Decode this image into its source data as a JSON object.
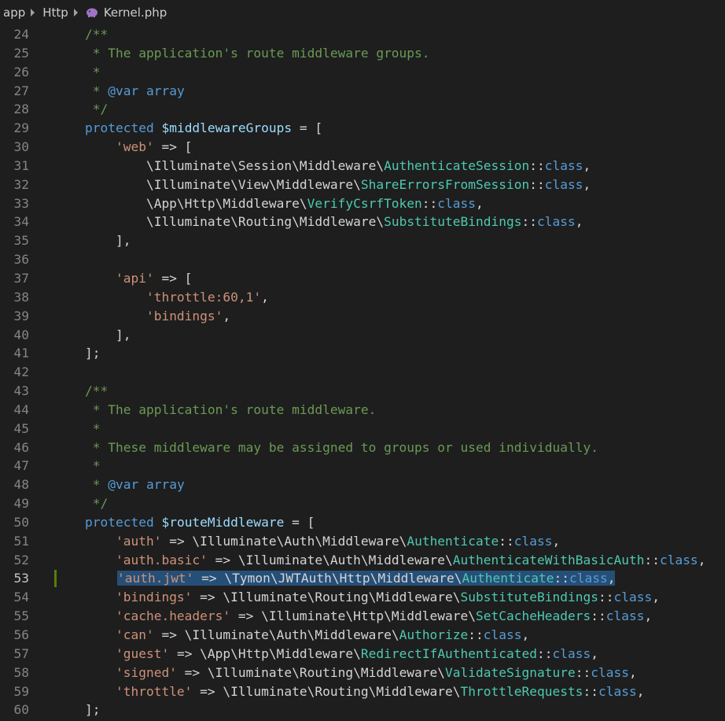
{
  "breadcrumb": {
    "items": [
      "app",
      "Http",
      "Kernel.php"
    ]
  },
  "editor": {
    "active_line": 53,
    "modified_line": 53,
    "lines": [
      {
        "n": "24",
        "tokens": [
          [
            "cm",
            "    /**"
          ]
        ]
      },
      {
        "n": "25",
        "tokens": [
          [
            "cm",
            "     * The application's route middleware groups."
          ]
        ]
      },
      {
        "n": "26",
        "tokens": [
          [
            "cm",
            "     *"
          ]
        ]
      },
      {
        "n": "27",
        "tokens": [
          [
            "cm",
            "     * "
          ],
          [
            "kw",
            "@var"
          ],
          [
            "cm",
            " "
          ],
          [
            "kw",
            "array"
          ]
        ]
      },
      {
        "n": "28",
        "tokens": [
          [
            "cm",
            "     */"
          ]
        ]
      },
      {
        "n": "29",
        "tokens": [
          [
            "kw",
            "    protected "
          ],
          [
            "var",
            "$middlewareGroups"
          ],
          [
            "op",
            " = ["
          ]
        ]
      },
      {
        "n": "30",
        "tokens": [
          [
            "op",
            "        "
          ],
          [
            "str",
            "'web'"
          ],
          [
            "op",
            " => ["
          ]
        ]
      },
      {
        "n": "31",
        "tokens": [
          [
            "op",
            "            \\Illuminate\\Session\\Middleware\\"
          ],
          [
            "cls",
            "AuthenticateSession"
          ],
          [
            "op",
            "::"
          ],
          [
            "kw",
            "class"
          ],
          [
            "op",
            ","
          ]
        ]
      },
      {
        "n": "32",
        "tokens": [
          [
            "op",
            "            \\Illuminate\\View\\Middleware\\"
          ],
          [
            "cls",
            "ShareErrorsFromSession"
          ],
          [
            "op",
            "::"
          ],
          [
            "kw",
            "class"
          ],
          [
            "op",
            ","
          ]
        ]
      },
      {
        "n": "33",
        "tokens": [
          [
            "op",
            "            \\App\\Http\\Middleware\\"
          ],
          [
            "cls",
            "VerifyCsrfToken"
          ],
          [
            "op",
            "::"
          ],
          [
            "kw",
            "class"
          ],
          [
            "op",
            ","
          ]
        ]
      },
      {
        "n": "34",
        "tokens": [
          [
            "op",
            "            \\Illuminate\\Routing\\Middleware\\"
          ],
          [
            "cls",
            "SubstituteBindings"
          ],
          [
            "op",
            "::"
          ],
          [
            "kw",
            "class"
          ],
          [
            "op",
            ","
          ]
        ]
      },
      {
        "n": "35",
        "tokens": [
          [
            "op",
            "        ],"
          ]
        ]
      },
      {
        "n": "36",
        "tokens": []
      },
      {
        "n": "37",
        "tokens": [
          [
            "op",
            "        "
          ],
          [
            "str",
            "'api'"
          ],
          [
            "op",
            " => ["
          ]
        ]
      },
      {
        "n": "38",
        "tokens": [
          [
            "op",
            "            "
          ],
          [
            "str",
            "'throttle:60,1'"
          ],
          [
            "op",
            ","
          ]
        ]
      },
      {
        "n": "39",
        "tokens": [
          [
            "op",
            "            "
          ],
          [
            "str",
            "'bindings'"
          ],
          [
            "op",
            ","
          ]
        ]
      },
      {
        "n": "40",
        "tokens": [
          [
            "op",
            "        ],"
          ]
        ]
      },
      {
        "n": "41",
        "tokens": [
          [
            "op",
            "    ];"
          ]
        ]
      },
      {
        "n": "42",
        "tokens": []
      },
      {
        "n": "43",
        "tokens": [
          [
            "cm",
            "    /**"
          ]
        ]
      },
      {
        "n": "44",
        "tokens": [
          [
            "cm",
            "     * The application's route middleware."
          ]
        ]
      },
      {
        "n": "45",
        "tokens": [
          [
            "cm",
            "     *"
          ]
        ]
      },
      {
        "n": "46",
        "tokens": [
          [
            "cm",
            "     * These middleware may be assigned to groups or used individually."
          ]
        ]
      },
      {
        "n": "47",
        "tokens": [
          [
            "cm",
            "     *"
          ]
        ]
      },
      {
        "n": "48",
        "tokens": [
          [
            "cm",
            "     * "
          ],
          [
            "kw",
            "@var"
          ],
          [
            "cm",
            " "
          ],
          [
            "kw",
            "array"
          ]
        ]
      },
      {
        "n": "49",
        "tokens": [
          [
            "cm",
            "     */"
          ]
        ]
      },
      {
        "n": "50",
        "tokens": [
          [
            "kw",
            "    protected "
          ],
          [
            "var",
            "$routeMiddleware"
          ],
          [
            "op",
            " = ["
          ]
        ]
      },
      {
        "n": "51",
        "tokens": [
          [
            "op",
            "        "
          ],
          [
            "str",
            "'auth'"
          ],
          [
            "op",
            " => \\Illuminate\\Auth\\Middleware\\"
          ],
          [
            "cls",
            "Authenticate"
          ],
          [
            "op",
            "::"
          ],
          [
            "kw",
            "class"
          ],
          [
            "op",
            ","
          ]
        ]
      },
      {
        "n": "52",
        "tokens": [
          [
            "op",
            "        "
          ],
          [
            "str",
            "'auth.basic'"
          ],
          [
            "op",
            " => \\Illuminate\\Auth\\Middleware\\"
          ],
          [
            "cls",
            "AuthenticateWithBasicAuth"
          ],
          [
            "op",
            "::"
          ],
          [
            "kw",
            "class"
          ],
          [
            "op",
            ","
          ]
        ]
      },
      {
        "n": "53",
        "tokens": [
          [
            "op",
            "        "
          ],
          [
            "str",
            "'auth.jwt'"
          ],
          [
            "op",
            " => \\Tymon\\JWTAuth\\Http\\Middleware\\"
          ],
          [
            "cls",
            "Authenticate"
          ],
          [
            "op",
            "::"
          ],
          [
            "kw",
            "class"
          ],
          [
            "op",
            ","
          ]
        ]
      },
      {
        "n": "54",
        "tokens": [
          [
            "op",
            "        "
          ],
          [
            "str",
            "'bindings'"
          ],
          [
            "op",
            " => \\Illuminate\\Routing\\Middleware\\"
          ],
          [
            "cls",
            "SubstituteBindings"
          ],
          [
            "op",
            "::"
          ],
          [
            "kw",
            "class"
          ],
          [
            "op",
            ","
          ]
        ]
      },
      {
        "n": "55",
        "tokens": [
          [
            "op",
            "        "
          ],
          [
            "str",
            "'cache.headers'"
          ],
          [
            "op",
            " => \\Illuminate\\Http\\Middleware\\"
          ],
          [
            "cls",
            "SetCacheHeaders"
          ],
          [
            "op",
            "::"
          ],
          [
            "kw",
            "class"
          ],
          [
            "op",
            ","
          ]
        ]
      },
      {
        "n": "56",
        "tokens": [
          [
            "op",
            "        "
          ],
          [
            "str",
            "'can'"
          ],
          [
            "op",
            " => \\Illuminate\\Auth\\Middleware\\"
          ],
          [
            "cls",
            "Authorize"
          ],
          [
            "op",
            "::"
          ],
          [
            "kw",
            "class"
          ],
          [
            "op",
            ","
          ]
        ]
      },
      {
        "n": "57",
        "tokens": [
          [
            "op",
            "        "
          ],
          [
            "str",
            "'guest'"
          ],
          [
            "op",
            " => \\App\\Http\\Middleware\\"
          ],
          [
            "cls",
            "RedirectIfAuthenticated"
          ],
          [
            "op",
            "::"
          ],
          [
            "kw",
            "class"
          ],
          [
            "op",
            ","
          ]
        ]
      },
      {
        "n": "58",
        "tokens": [
          [
            "op",
            "        "
          ],
          [
            "str",
            "'signed'"
          ],
          [
            "op",
            " => \\Illuminate\\Routing\\Middleware\\"
          ],
          [
            "cls",
            "ValidateSignature"
          ],
          [
            "op",
            "::"
          ],
          [
            "kw",
            "class"
          ],
          [
            "op",
            ","
          ]
        ]
      },
      {
        "n": "59",
        "tokens": [
          [
            "op",
            "        "
          ],
          [
            "str",
            "'throttle'"
          ],
          [
            "op",
            " => \\Illuminate\\Routing\\Middleware\\"
          ],
          [
            "cls",
            "ThrottleRequests"
          ],
          [
            "op",
            "::"
          ],
          [
            "kw",
            "class"
          ],
          [
            "op",
            ","
          ]
        ]
      },
      {
        "n": "60",
        "tokens": [
          [
            "op",
            "    ];"
          ]
        ]
      }
    ]
  },
  "colors": {
    "background": "#1e1e1e",
    "comment": "#6a9955",
    "keyword": "#569cd6",
    "variable": "#9cdcfe",
    "string": "#ce9178",
    "class": "#4ec9b0",
    "text": "#d4d4d4",
    "selection": "#264f78",
    "modified_marker": "#587c0c"
  }
}
